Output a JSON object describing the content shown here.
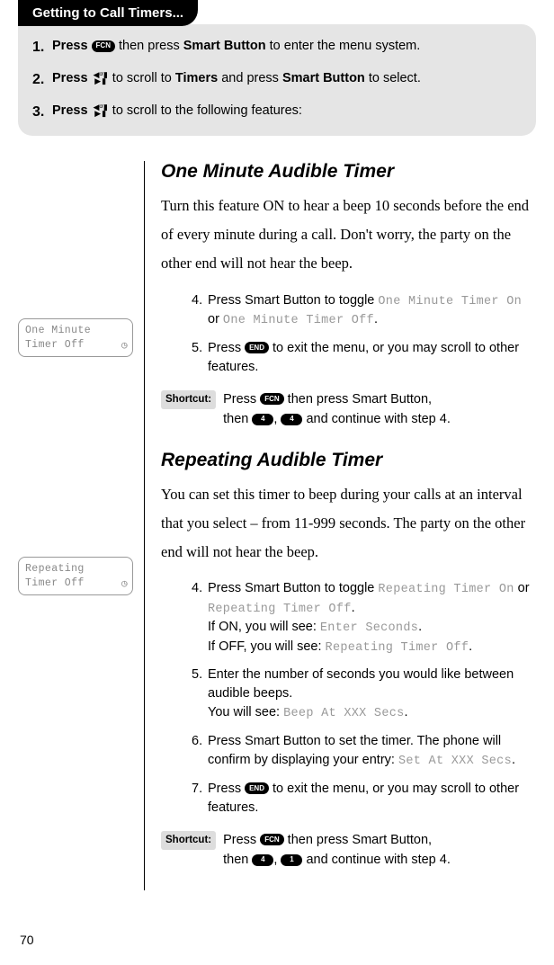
{
  "header": {
    "title": "Getting to Call Timers..."
  },
  "steps": [
    {
      "num": "1.",
      "pre": "Press ",
      "key": "FCN",
      "post": " then press ",
      "bold1": "Smart Button",
      "tail": " to enter the menu system."
    },
    {
      "num": "2.",
      "pre": "Press ",
      "mid": " to scroll to ",
      "bold1": "Timers",
      "mid2": " and press ",
      "bold2": "Smart Button",
      "tail": " to select."
    },
    {
      "num": "3.",
      "pre": "Press ",
      "mid": " to scroll to the following features:"
    }
  ],
  "screen1": {
    "line1": "One Minute",
    "line2": "Timer Off",
    "clock": "◷"
  },
  "screen2": {
    "line1": "Repeating",
    "line2": "Timer Off",
    "clock": "◷"
  },
  "sec1": {
    "title": "One Minute Audible Timer",
    "intro": "Turn this feature ON to hear a beep 10 seconds before the end of every minute during a call. Don't worry, the party on the other end will not hear the beep.",
    "s4a": "Press Smart Button to toggle ",
    "s4code1": "One Minute Timer On",
    "s4or": " or ",
    "s4code2": "One Minute Timer Off",
    "s4dot": ".",
    "s5a": "Press ",
    "s5key": "END",
    "s5b": " to exit the menu, or you may scroll to other features.",
    "shortcut_label": "Shortcut:",
    "sh_a": "Press ",
    "sh_key": "FCN",
    "sh_b": " then press Smart Button,",
    "sh_c": "then ",
    "sh_k1": "4",
    "sh_comma": ", ",
    "sh_k2": "4",
    "sh_d": " and continue with step 4."
  },
  "sec2": {
    "title": "Repeating Audible Timer",
    "intro": "You can set this timer to beep during your calls at an interval that you select – from 11-999 seconds. The party on the other end will not hear the beep.",
    "s4a": "Press Smart Button to toggle ",
    "s4code1": "Repeating Timer On",
    "s4or": " or ",
    "s4code2": "Repeating Timer Off",
    "s4dot": ".",
    "s4line2a": "If ON, you will see: ",
    "s4line2code": "Enter Seconds",
    "s4line2dot": ".",
    "s4line3a": "If OFF, you will see: ",
    "s4line3code": "Repeating Timer Off",
    "s4line3dot": ".",
    "s5a": "Enter the number of seconds you would like between audible beeps.",
    "s5b": "You will see: ",
    "s5code": "Beep At XXX Secs",
    "s5dot": ".",
    "s6a": "Press Smart Button to set the timer. The phone will confirm by displaying your entry: ",
    "s6code": "Set At XXX Secs",
    "s6dot": ".",
    "s7a": "Press ",
    "s7key": "END",
    "s7b": " to exit the menu, or you may scroll to other features.",
    "shortcut_label": "Shortcut:",
    "sh_a": "Press ",
    "sh_key": "FCN",
    "sh_b": " then press Smart Button,",
    "sh_c": "then ",
    "sh_k1": "4",
    "sh_comma": ", ",
    "sh_k2": "1",
    "sh_d": " and continue with step 4."
  },
  "pagenum": "70"
}
